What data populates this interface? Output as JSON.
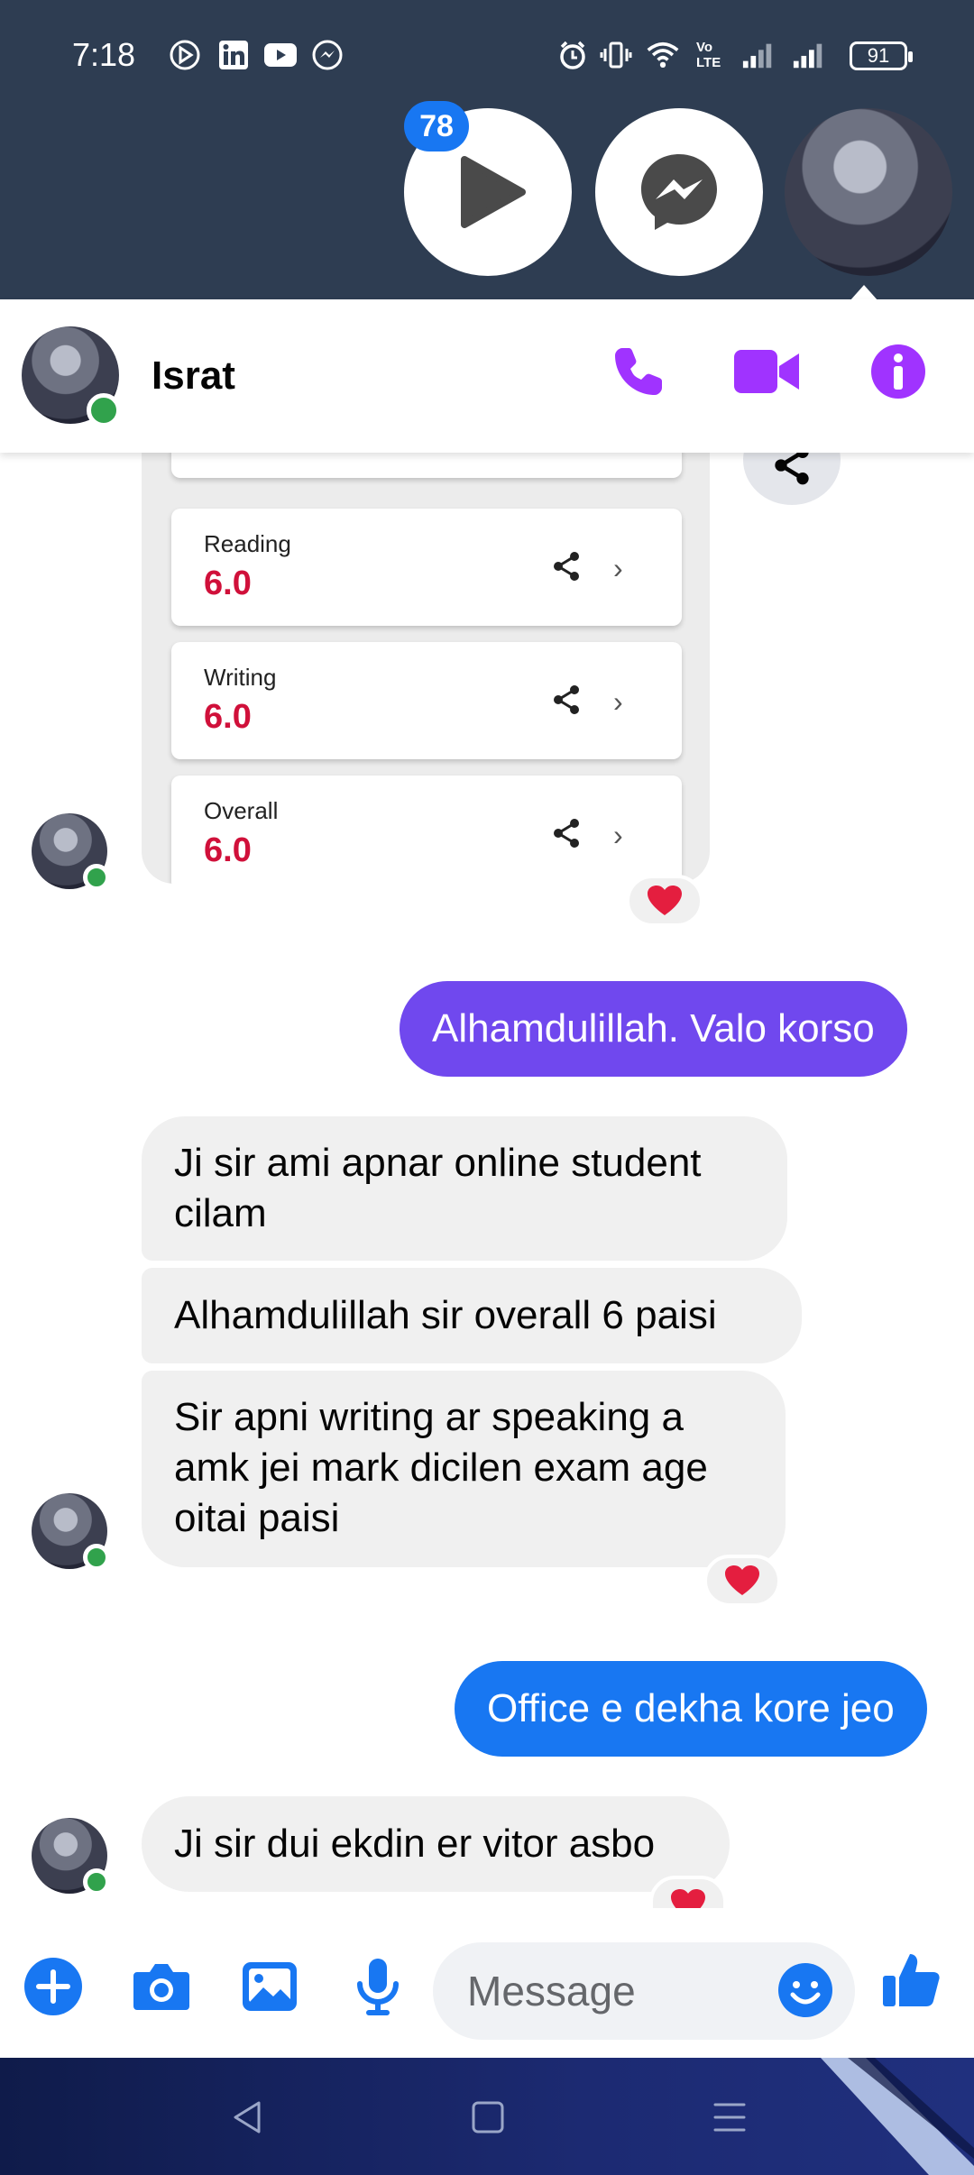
{
  "status_bar": {
    "time": "7:18",
    "battery": "91",
    "network_label": "Vo LTE"
  },
  "chat_heads": {
    "video_badge_count": "78"
  },
  "header": {
    "contact_name": "Israt"
  },
  "shared_image": {
    "scores": [
      {
        "label": "Reading",
        "value": "6.0"
      },
      {
        "label": "Writing",
        "value": "6.0"
      },
      {
        "label": "Overall",
        "value": "6.0"
      }
    ]
  },
  "messages": [
    {
      "from": "me",
      "text": "Alhamdulillah. Valo korso"
    },
    {
      "from": "them",
      "text": "Ji sir ami apnar online student cilam"
    },
    {
      "from": "them",
      "text": "Alhamdulillah sir overall 6 paisi"
    },
    {
      "from": "them",
      "text": "Sir apni writing ar speaking a amk jei mark dicilen exam age oitai paisi"
    },
    {
      "from": "me",
      "text": "Office e dekha kore jeo"
    },
    {
      "from": "them",
      "text": "Ji sir dui ekdin er vitor asbo"
    }
  ],
  "composer": {
    "placeholder": "Message"
  },
  "colors": {
    "messenger_purple": "#a033ff",
    "bubble_purple": "#7048ee",
    "bubble_blue": "#1877f2",
    "score_red": "#d0103a",
    "online_green": "#31a24c"
  }
}
